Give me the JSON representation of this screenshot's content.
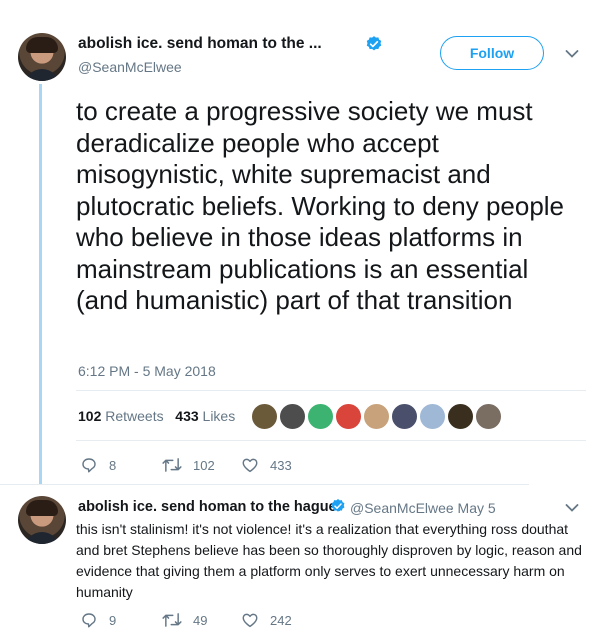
{
  "tweet": {
    "author_name": "abolish ice. send homan to the ...",
    "author_handle": "@SeanMcElwee",
    "follow_label": "Follow",
    "text": "to create a progressive society we must deradicalize people who accept misogynistic, white supremacist and plutocratic beliefs. Working to deny people who believe in those ideas platforms in mainstream publications is an essential (and humanistic) part of that transition",
    "timestamp": "6:12 PM - 5 May 2018",
    "retweets_count": "102",
    "retweets_label": "Retweets",
    "likes_count": "433",
    "likes_label": "Likes",
    "actions": {
      "replies": "8",
      "retweets": "102",
      "likes": "433"
    },
    "liker_colors": [
      "#6b5a3a",
      "#4d4d4d",
      "#3cb371",
      "#d9443b",
      "#c8a27a",
      "#4a4f6b",
      "#9fb8d6",
      "#3a2f1e",
      "#7a6d62"
    ]
  },
  "reply": {
    "author_name": "abolish ice. send homan to the hague.",
    "author_handle": "@SeanMcElwee",
    "date": "· May 5",
    "text": "this isn't stalinism! it's not violence! it's a realization that everything ross douthat and bret Stephens believe has been so thoroughly disproven by logic, reason and evidence that giving them a platform only serves to exert unnecessary harm on humanity",
    "actions": {
      "replies": "9",
      "retweets": "49",
      "likes": "242"
    }
  },
  "colors": {
    "accent": "#1da1f2",
    "muted": "#657786",
    "thread_line": "#a9d6f2"
  }
}
